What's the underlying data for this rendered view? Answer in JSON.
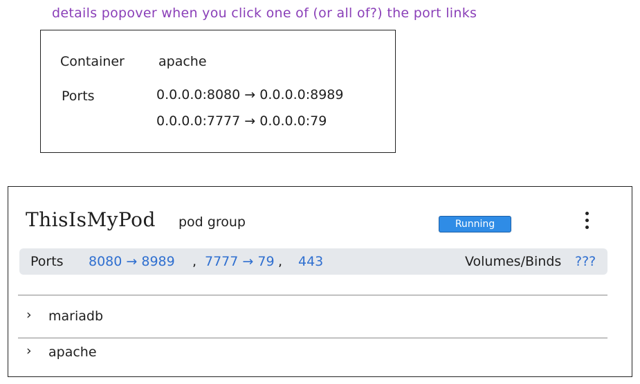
{
  "annotation": "details popover when you click one of (or all of?) the port links",
  "popover": {
    "container_label": "Container",
    "container_value": "apache",
    "ports_label": "Ports",
    "ports": [
      "0.0.0.0:8080 → 0.0.0.0:8989",
      "0.0.0.0:7777 → 0.0.0.0:79"
    ]
  },
  "pod": {
    "name": "ThisIsMyPod",
    "type": "pod group",
    "status": "Running",
    "status_color": "#2f8ce6",
    "menu_icon": "kebab-icon",
    "info_bar": {
      "ports_label": "Ports",
      "ports": [
        "8080 → 8989",
        "7777 → 79",
        "443"
      ],
      "volumes_label": "Volumes/Binds",
      "volumes_value": "???"
    },
    "link_color": "#2f6fd0",
    "containers": [
      {
        "name": "mariadb",
        "icon": "chevron-right-icon"
      },
      {
        "name": "apache",
        "icon": "chevron-right-icon"
      }
    ]
  }
}
